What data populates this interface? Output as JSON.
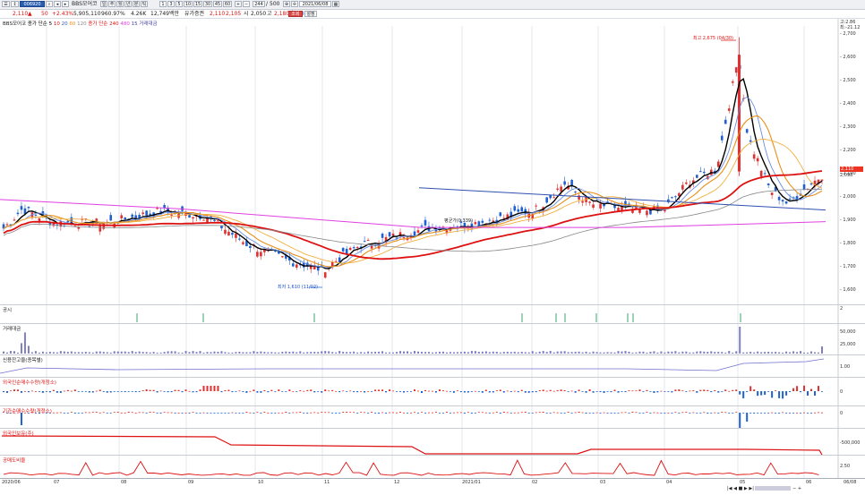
{
  "toolbar": {
    "code": "006920",
    "name": "BBS모어코",
    "price": "2,110",
    "change_arrow": "▲",
    "change": "50",
    "change_pct": "+2.43%",
    "volume": "5,905,110",
    "ratio": "960.97%",
    "vol2": "4.26K",
    "amount": "12,749백만",
    "market": "유가증권",
    "open_label": "시",
    "open": "2,050",
    "high_label": "고",
    "high": "2,180",
    "low_label": "저",
    "low": "2,045",
    "close_label": "",
    "close": "2,110",
    "current": "2,105",
    "count": "244",
    "count_total": "500",
    "date": "2021/06/08",
    "btn_refresh": "조회",
    "btn_settings": "설정",
    "periods": [
      "1",
      "3",
      "5",
      "10",
      "15",
      "30",
      "45",
      "60"
    ],
    "period_tabs": [
      "주",
      "월",
      "년",
      "분",
      "초",
      "틱"
    ]
  },
  "main_panel": {
    "title": "BBS모어코",
    "legend": [
      "종가 단순 5",
      "10",
      "20",
      "60",
      "120",
      "종가 단순 240",
      "480",
      "15",
      "거래대금"
    ],
    "legend_colors": [
      "#000000",
      "#d11",
      "#2a5db0",
      "#e8901a",
      "#888888",
      "#d11",
      "#e040e0",
      "#4444aa",
      "#4444aa"
    ],
    "scale_labels": [
      "2,700",
      "2,600",
      "2,500",
      "2,400",
      "2,300",
      "2,200",
      "2,100",
      "2,000",
      "1,900",
      "1,800",
      "1,700",
      "1,600"
    ],
    "price_tag": "2,110",
    "price_tag2": "2,098",
    "top_right_1": "고:2.86",
    "top_right_2": "최:-21.12",
    "high_note": "최고 2,675 (04/30)",
    "low_note": "최저 1,610 (11/02)",
    "mid_note": "평균가(0,339)"
  },
  "panels": [
    {
      "title": "공시",
      "scale": [
        "2"
      ]
    },
    {
      "title": "거래대금",
      "scale": [
        "50,000",
        "25,000"
      ]
    },
    {
      "title": "신용잔고율(종목별)",
      "scale": [
        "1.00"
      ]
    },
    {
      "title": "외국인순매수수량(개정소)",
      "scale": [
        "0"
      ]
    },
    {
      "title": "기관순매수수량(개정소)",
      "scale": [
        "0"
      ]
    },
    {
      "title": "외국인보유(주)",
      "scale": [
        "-500,000"
      ]
    },
    {
      "title": "공매도비율",
      "scale": [
        "2.50"
      ]
    }
  ],
  "x_axis": [
    "2020/06",
    "07",
    "08",
    "09",
    "10",
    "11",
    "12",
    "2021/01",
    "02",
    "03",
    "04",
    "05",
    "06",
    "06/08"
  ],
  "chart_data": {
    "type": "line",
    "series": [
      {
        "name": "종가 단순 5",
        "color": "#000000"
      },
      {
        "name": "종가 단순 240",
        "color": "#d11"
      }
    ],
    "ylim": [
      1600,
      2700
    ],
    "x": [
      "2020/06",
      "07",
      "08",
      "09",
      "10",
      "11",
      "12",
      "2021/01",
      "02",
      "03",
      "04",
      "05",
      "06"
    ]
  }
}
